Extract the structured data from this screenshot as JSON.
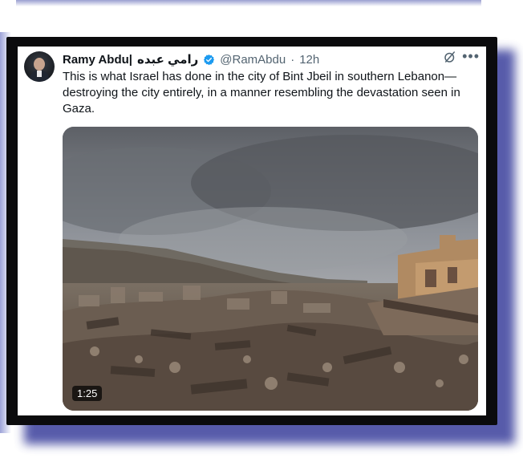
{
  "tweet": {
    "display_name": "Ramy Abdu|",
    "display_name_ar": "رامي عبده",
    "handle": "@RamAbdu",
    "separator": "·",
    "time": "12h",
    "text": "This is what Israel has done in the city of Bint Jbeil in southern Lebanon—destroying the city entirely, in a manner resembling the devastation seen in Gaza.",
    "media": {
      "duration": "1:25"
    },
    "icons": {
      "verified": "verified-badge-icon",
      "grok": "grok-icon",
      "more": "more-icon"
    },
    "colors": {
      "verified": "#1d9bf0",
      "secondary_text": "#536471",
      "primary_text": "#0f1419"
    }
  }
}
